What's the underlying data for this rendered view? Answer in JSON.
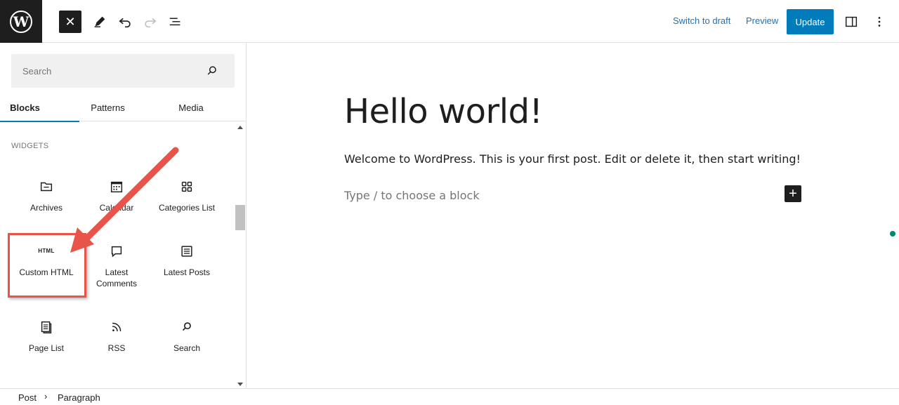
{
  "toolbar": {
    "logo": "W",
    "close_icon": "close-icon",
    "switch_to_draft": "Switch to draft",
    "preview": "Preview",
    "update": "Update"
  },
  "sidebar": {
    "search_placeholder": "Search",
    "tabs": [
      {
        "label": "Blocks",
        "active": true
      },
      {
        "label": "Patterns",
        "active": false
      },
      {
        "label": "Media",
        "active": false
      }
    ],
    "category": "WIDGETS",
    "blocks": [
      {
        "label": "Archives",
        "icon": "folder-icon"
      },
      {
        "label": "Calendar",
        "icon": "calendar-icon"
      },
      {
        "label": "Categories List",
        "icon": "categories-icon"
      },
      {
        "label": "Custom HTML",
        "icon": "html-icon",
        "icon_text": "HTML"
      },
      {
        "label": "Latest Comments",
        "icon": "comment-icon"
      },
      {
        "label": "Latest Posts",
        "icon": "post-list-icon"
      },
      {
        "label": "Page List",
        "icon": "page-list-icon"
      },
      {
        "label": "RSS",
        "icon": "rss-icon"
      },
      {
        "label": "Search",
        "icon": "search-icon"
      }
    ]
  },
  "editor": {
    "title": "Hello world!",
    "paragraph": "Welcome to WordPress. This is your first post. Edit or delete it, then start writing!",
    "placeholder": "Type / to choose a block",
    "inserter": "+"
  },
  "footer": {
    "breadcrumbs": [
      "Post",
      "Paragraph"
    ]
  },
  "colors": {
    "accent": "#007cba",
    "link": "#2271b1",
    "annotation": "#e8544a",
    "dark": "#1e1e1e"
  }
}
